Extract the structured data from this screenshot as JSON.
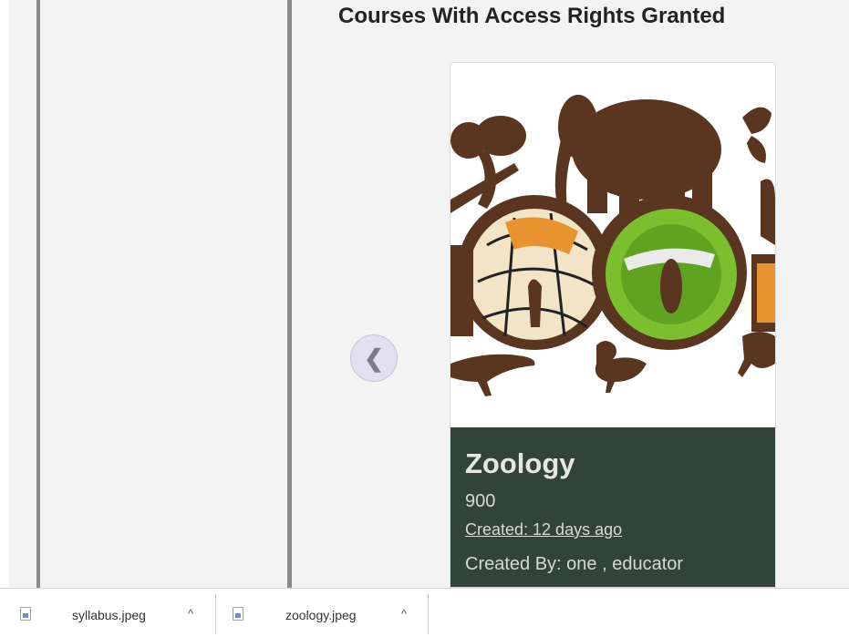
{
  "main": {
    "title": "Courses With Access Rights Granted"
  },
  "carousel": {
    "prev_glyph": "❮",
    "card": {
      "title": "Zoology",
      "code": "900",
      "created": "Created: 12 days ago",
      "created_by": "Created By: one , educator"
    }
  },
  "downloads": [
    {
      "filename": "syllabus.jpeg",
      "icon": "image-file-icon",
      "chevron": "^"
    },
    {
      "filename": "zoology.jpeg",
      "icon": "image-file-icon",
      "chevron": "^"
    }
  ],
  "colors": {
    "card_body": "#32433a",
    "sidebar_border": "#8a8a8a",
    "prev_button": "#e3e0ef"
  }
}
